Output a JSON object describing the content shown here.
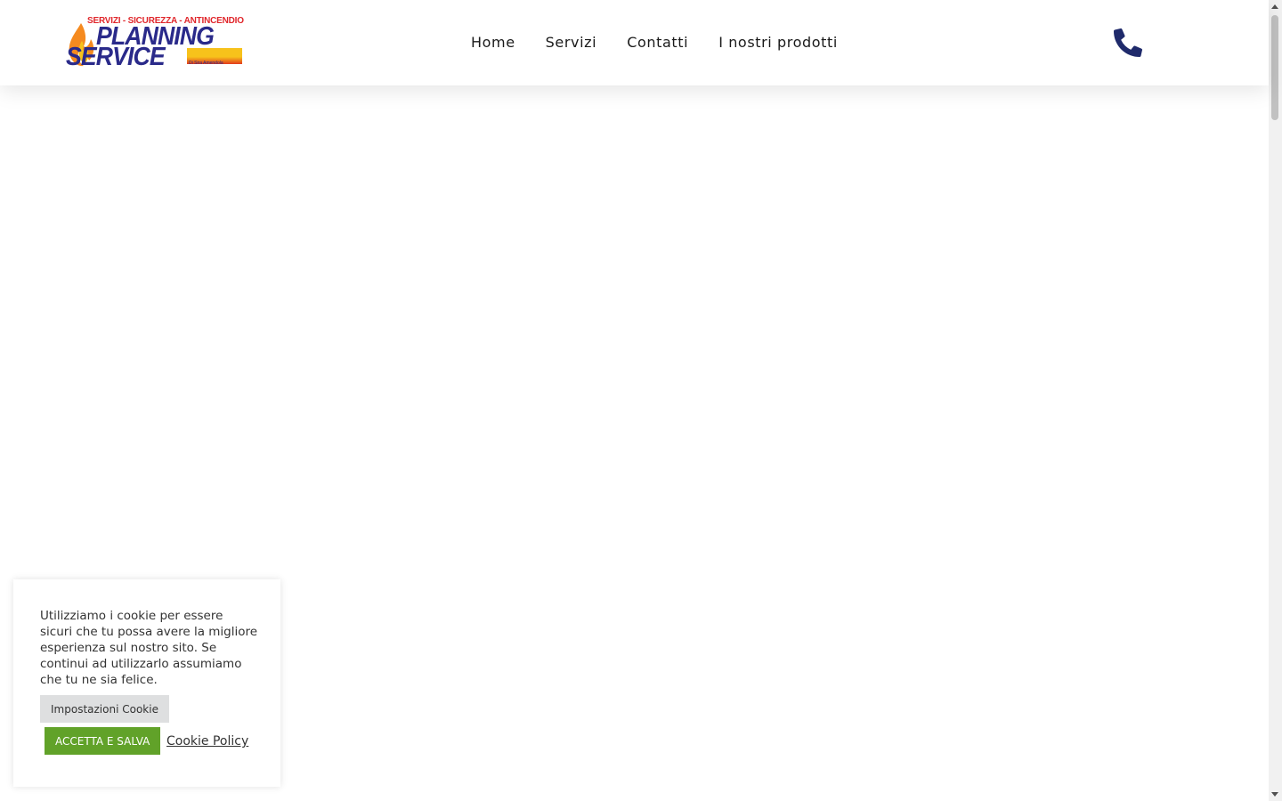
{
  "header": {
    "logo": {
      "tagline": "SERVIZI - SICUREZZA - ANTINCENDIO",
      "word1": "PLANNING",
      "word2": "SERVICE",
      "owner": "Di Sira Amendola"
    },
    "nav": [
      {
        "label": "Home"
      },
      {
        "label": "Servizi"
      },
      {
        "label": "Contatti"
      },
      {
        "label": "I nostri prodotti"
      }
    ],
    "phone_icon": "phone-icon"
  },
  "cookie_banner": {
    "message": "Utilizziamo i cookie per essere sicuri che tu possa avere la migliore esperienza sul nostro sito. Se continui ad utilizzarlo assumiamo che tu ne sia felice.",
    "settings_label": "Impostazioni Cookie",
    "accept_label": "ACCETTA E SALVA",
    "policy_label": "Cookie Policy"
  },
  "colors": {
    "brand_blue": "#2a2a8a",
    "brand_red": "#e0262b",
    "brand_yellow": "#f7c21b",
    "accept_green": "#61a229",
    "phone_icon": "#1f2a6b"
  }
}
